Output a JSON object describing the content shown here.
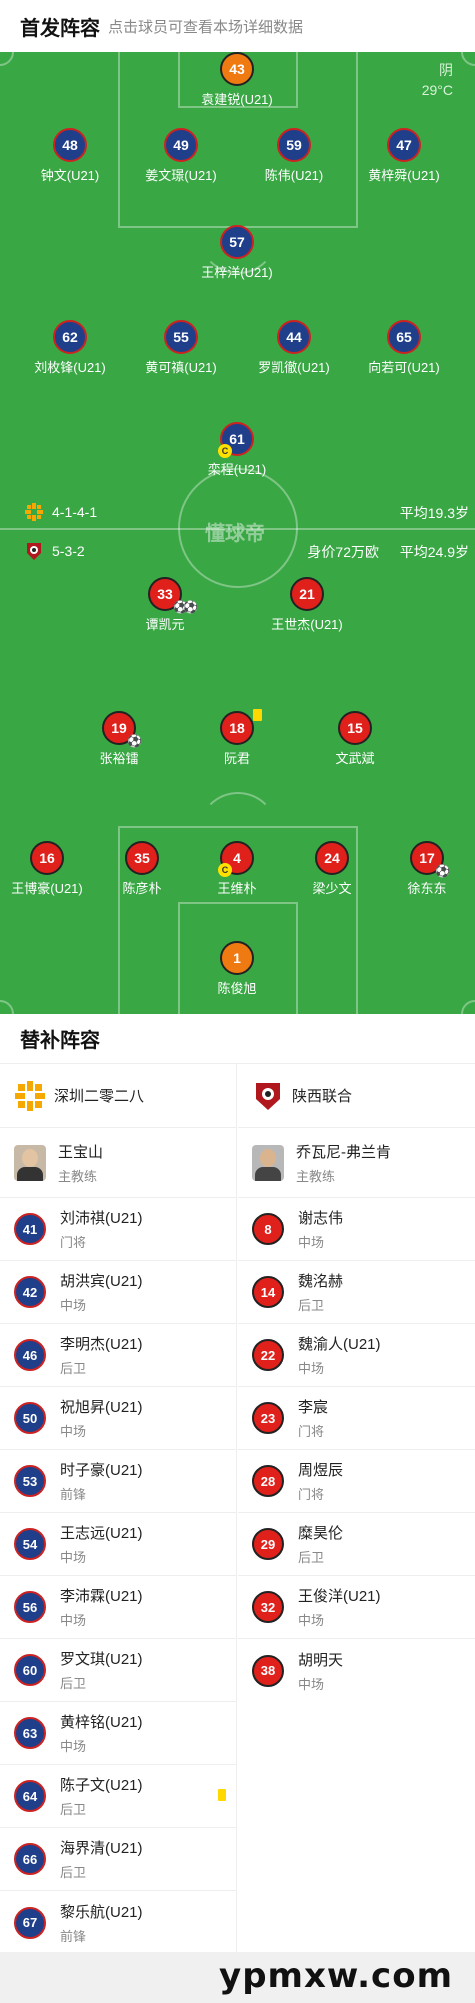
{
  "header": {
    "title": "首发阵容",
    "hint": "点击球员可查看本场详细数据"
  },
  "weather": {
    "condition": "阴",
    "temperature": "29°C"
  },
  "pitch_watermark": "懂球帝",
  "home_team": {
    "formation": "4-1-4-1",
    "avg_age": "平均19.3岁",
    "logo_icon": "shenzhen-2028-logo-icon",
    "players": [
      {
        "number": "43",
        "name": "袁建锐(U21)",
        "color": "orange"
      },
      {
        "number": "48",
        "name": "钟文(U21)",
        "color": "blue"
      },
      {
        "number": "49",
        "name": "姜文璟(U21)",
        "color": "blue"
      },
      {
        "number": "59",
        "name": "陈伟(U21)",
        "color": "blue"
      },
      {
        "number": "47",
        "name": "黄梓舜(U21)",
        "color": "blue"
      },
      {
        "number": "57",
        "name": "王梓洋(U21)",
        "color": "blue"
      },
      {
        "number": "62",
        "name": "刘枚锋(U21)",
        "color": "blue"
      },
      {
        "number": "55",
        "name": "黄可禛(U21)",
        "color": "blue"
      },
      {
        "number": "44",
        "name": "罗凯徹(U21)",
        "color": "blue"
      },
      {
        "number": "65",
        "name": "向若可(U21)",
        "color": "blue"
      },
      {
        "number": "61",
        "name": "栾程(U21)",
        "color": "blue",
        "captain": "C"
      }
    ]
  },
  "away_team": {
    "formation": "5-3-2",
    "market_value": "身价72万欧",
    "avg_age": "平均24.9岁",
    "logo_icon": "shaanxi-union-logo-icon",
    "players": [
      {
        "number": "33",
        "name": "谭凯元",
        "color": "red"
      },
      {
        "number": "21",
        "name": "王世杰(U21)",
        "color": "red"
      },
      {
        "number": "19",
        "name": "张裕镭",
        "color": "red"
      },
      {
        "number": "18",
        "name": "阮君",
        "color": "red"
      },
      {
        "number": "15",
        "name": "文武斌",
        "color": "red"
      },
      {
        "number": "16",
        "name": "王博豪(U21)",
        "color": "red"
      },
      {
        "number": "35",
        "name": "陈彦朴",
        "color": "red"
      },
      {
        "number": "4",
        "name": "王维朴",
        "color": "red",
        "captain": "C"
      },
      {
        "number": "24",
        "name": "梁少文",
        "color": "red"
      },
      {
        "number": "17",
        "name": "徐东东",
        "color": "red"
      },
      {
        "number": "1",
        "name": "陈俊旭",
        "color": "orange"
      }
    ]
  },
  "subs": {
    "title": "替补阵容",
    "left": {
      "team_name": "深圳二零二八",
      "coach_name": "王宝山",
      "coach_role": "主教练",
      "players": [
        {
          "number": "41",
          "name": "刘沛祺(U21)",
          "pos": "门将"
        },
        {
          "number": "42",
          "name": "胡洪宾(U21)",
          "pos": "中场"
        },
        {
          "number": "46",
          "name": "李明杰(U21)",
          "pos": "后卫"
        },
        {
          "number": "50",
          "name": "祝旭昇(U21)",
          "pos": "中场"
        },
        {
          "number": "53",
          "name": "时子豪(U21)",
          "pos": "前锋"
        },
        {
          "number": "54",
          "name": "王志远(U21)",
          "pos": "中场"
        },
        {
          "number": "56",
          "name": "李沛霖(U21)",
          "pos": "中场"
        },
        {
          "number": "60",
          "name": "罗文琪(U21)",
          "pos": "后卫"
        },
        {
          "number": "63",
          "name": "黄梓铭(U21)",
          "pos": "中场"
        },
        {
          "number": "64",
          "name": "陈子文(U21)",
          "pos": "后卫"
        },
        {
          "number": "66",
          "name": "海界清(U21)",
          "pos": "后卫"
        },
        {
          "number": "67",
          "name": "黎乐航(U21)",
          "pos": "前锋"
        }
      ]
    },
    "right": {
      "team_name": "陕西联合",
      "coach_name": "乔瓦尼-弗兰肯",
      "coach_role": "主教练",
      "players": [
        {
          "number": "8",
          "name": "谢志伟",
          "pos": "中场"
        },
        {
          "number": "14",
          "name": "魏洺赫",
          "pos": "后卫"
        },
        {
          "number": "22",
          "name": "魏渝人(U21)",
          "pos": "中场"
        },
        {
          "number": "23",
          "name": "李宸",
          "pos": "门将"
        },
        {
          "number": "28",
          "name": "周煜辰",
          "pos": "门将"
        },
        {
          "number": "29",
          "name": "糜昊伦",
          "pos": "后卫"
        },
        {
          "number": "32",
          "name": "王俊洋(U21)",
          "pos": "中场"
        },
        {
          "number": "38",
          "name": "胡明天",
          "pos": "中场"
        }
      ]
    }
  },
  "footer": {
    "brand": "ypmxw.com"
  },
  "colors": {
    "pitch": "#3aa745",
    "home": "#1f3f8a",
    "away": "#e0201b",
    "keeper": "#f07a12"
  }
}
